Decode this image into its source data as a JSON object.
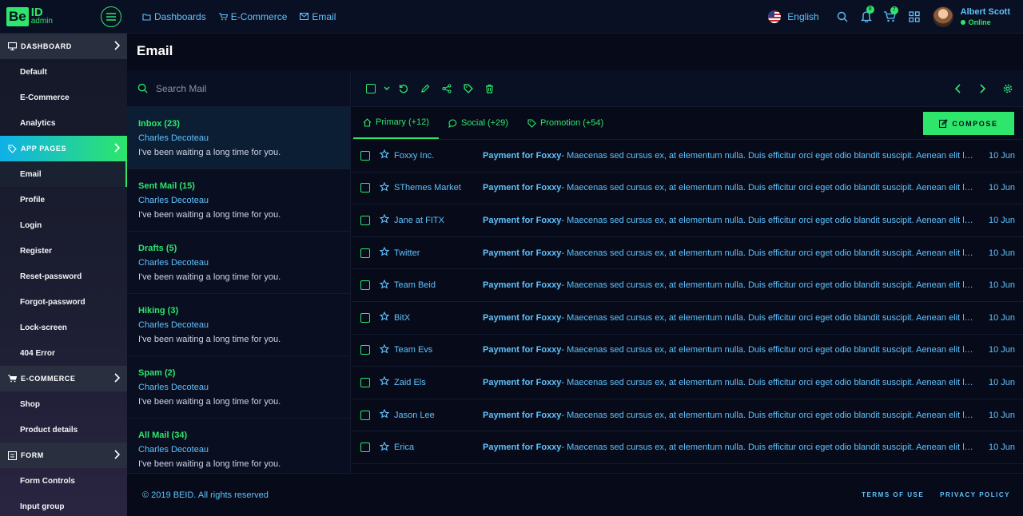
{
  "logo": {
    "be": "Be",
    "id": "ID",
    "sub": "admin"
  },
  "topnav": [
    {
      "label": "Dashboards",
      "icon": "folder-icon"
    },
    {
      "label": "E-Commerce",
      "icon": "cart-icon"
    },
    {
      "label": "Email",
      "icon": "mail-icon"
    }
  ],
  "header": {
    "language": "English",
    "notifications_count": "8",
    "cart_count": "7",
    "user": {
      "name": "Albert Scott",
      "status": "Online"
    }
  },
  "sidebar": {
    "dashboard": "DASHBOARD",
    "dashboard_items": [
      "Default",
      "E-Commerce",
      "Analytics"
    ],
    "app_pages": "APP PAGES",
    "app_pages_items": [
      "Email",
      "Profile",
      "Login",
      "Register",
      "Reset-password",
      "Forgot-password",
      "Lock-screen",
      "404 Error"
    ],
    "ecommerce": "E-COMMERCE",
    "ecommerce_items": [
      "Shop",
      "Product details"
    ],
    "form": "FORM",
    "form_items": [
      "Form Controls",
      "Input group"
    ]
  },
  "page": {
    "title": "Email"
  },
  "search": {
    "placeholder": "Search Mail"
  },
  "folders": [
    {
      "name": "Inbox (23)",
      "from": "Charles Decoteau",
      "snippet": "I've been waiting a long time for you."
    },
    {
      "name": "Sent Mail (15)",
      "from": "Charles Decoteau",
      "snippet": "I've been waiting a long time for you."
    },
    {
      "name": "Drafts (5)",
      "from": "Charles Decoteau",
      "snippet": "I've been waiting a long time for you."
    },
    {
      "name": "Hiking (3)",
      "from": "Charles Decoteau",
      "snippet": "I've been waiting a long time for you."
    },
    {
      "name": "Spam (2)",
      "from": "Charles Decoteau",
      "snippet": "I've been waiting a long time for you."
    },
    {
      "name": "All Mail (34)",
      "from": "Charles Decoteau",
      "snippet": "I've been waiting a long time for you."
    }
  ],
  "tabs": [
    {
      "label": "Primary (+12)",
      "icon": "home-icon"
    },
    {
      "label": "Social (+29)",
      "icon": "chat-icon"
    },
    {
      "label": "Promotion (+54)",
      "icon": "tag-icon"
    }
  ],
  "compose_label": "COMPOSE",
  "emails": [
    {
      "sender": "Foxxy Inc.",
      "subject": "Payment for Foxxy",
      "preview": " - Maecenas sed cursus ex, at elementum nulla. Duis efficitur orci eget odio blandit suscipit. Aenean elit leo, bibendum",
      "date": "10 Jun"
    },
    {
      "sender": "SThemes Market",
      "subject": "Payment for Foxxy",
      "preview": " - Maecenas sed cursus ex, at elementum nulla. Duis efficitur orci eget odio blandit suscipit. Aenean elit leo, bibendum",
      "date": "10 Jun"
    },
    {
      "sender": "Jane at FITX",
      "subject": "Payment for Foxxy",
      "preview": " - Maecenas sed cursus ex, at elementum nulla. Duis efficitur orci eget odio blandit suscipit. Aenean elit leo, bibendum",
      "date": "10 Jun"
    },
    {
      "sender": "Twitter",
      "subject": "Payment for Foxxy",
      "preview": " - Maecenas sed cursus ex, at elementum nulla. Duis efficitur orci eget odio blandit suscipit. Aenean elit leo, bibendum",
      "date": "10 Jun"
    },
    {
      "sender": "Team Beid",
      "subject": "Payment for Foxxy",
      "preview": " - Maecenas sed cursus ex, at elementum nulla. Duis efficitur orci eget odio blandit suscipit. Aenean elit leo, bibendum",
      "date": "10 Jun"
    },
    {
      "sender": "BitX",
      "subject": "Payment for Foxxy",
      "preview": " - Maecenas sed cursus ex, at elementum nulla. Duis efficitur orci eget odio blandit suscipit. Aenean elit leo, bibendum",
      "date": "10 Jun"
    },
    {
      "sender": "Team Evs",
      "subject": "Payment for Foxxy",
      "preview": " - Maecenas sed cursus ex, at elementum nulla. Duis efficitur orci eget odio blandit suscipit. Aenean elit leo, bibendum",
      "date": "10 Jun"
    },
    {
      "sender": "Zaid Els",
      "subject": "Payment for Foxxy",
      "preview": " - Maecenas sed cursus ex, at elementum nulla. Duis efficitur orci eget odio blandit suscipit. Aenean elit leo, bibendum",
      "date": "10 Jun"
    },
    {
      "sender": "Jason Lee",
      "subject": "Payment for Foxxy",
      "preview": " - Maecenas sed cursus ex, at elementum nulla. Duis efficitur orci eget odio blandit suscipit. Aenean elit leo, bibendum",
      "date": "10 Jun"
    },
    {
      "sender": "Erica",
      "subject": "Payment for Foxxy",
      "preview": " - Maecenas sed cursus ex, at elementum nulla. Duis efficitur orci eget odio blandit suscipit. Aenean elit leo, bibendum",
      "date": "10 Jun"
    }
  ],
  "footer": {
    "copyright": "© 2019 BEID. All rights reserved",
    "terms": "TERMS OF USE",
    "privacy": "PRIVACY POLICY"
  },
  "colors": {
    "accent": "#2ee66b",
    "link": "#5fc2ff",
    "background": "#070b19"
  }
}
